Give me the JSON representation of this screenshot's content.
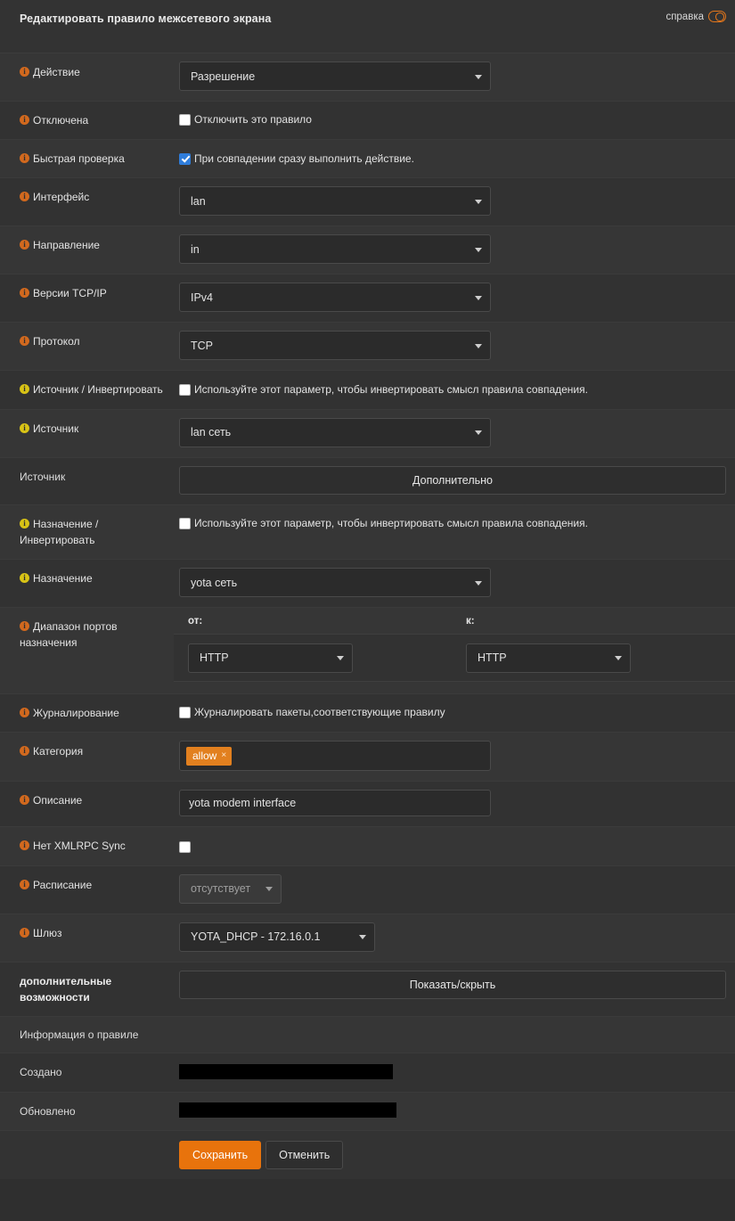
{
  "header": {
    "title": "Редактировать правило межсетевого экрана",
    "help_label": "справка",
    "help_toggle_icon": "toggle-switch-icon"
  },
  "accent": {
    "orange": "#e8730c",
    "info_orange": "#d2691e",
    "info_yellow": "#d8c316",
    "tag_orange": "#e2801f",
    "checkbox_blue": "#2f7ddb"
  },
  "fields": {
    "action": {
      "label": "Действие",
      "value": "Разрешение"
    },
    "disabled": {
      "label": "Отключена",
      "checkbox_label": "Отключить это правило",
      "checked": false
    },
    "quick": {
      "label": "Быстрая проверка",
      "checkbox_label": "При совпадении сразу выполнить действие.",
      "checked": true
    },
    "interface": {
      "label": "Интерфейс",
      "value": "lan"
    },
    "direction": {
      "label": "Направление",
      "value": "in"
    },
    "tcpip": {
      "label": "Версии TCP/IP",
      "value": "IPv4"
    },
    "protocol": {
      "label": "Протокол",
      "value": "TCP"
    },
    "source_invert": {
      "label": "Источник / Инвертировать",
      "checkbox_label": "Используйте этот параметр, чтобы инвертировать смысл правила совпадения.",
      "checked": false
    },
    "source": {
      "label": "Источник",
      "value": "lan сеть"
    },
    "source_advanced": {
      "label": "Источник",
      "button_label": "Дополнительно"
    },
    "dest_invert": {
      "label": "Назначение / Инвертировать",
      "checkbox_label": "Используйте этот параметр, чтобы инвертировать смысл правила совпадения.",
      "checked": false
    },
    "destination": {
      "label": "Назначение",
      "value": "yota сеть"
    },
    "dest_ports": {
      "label": "Диапазон портов назначения",
      "from_label": "от:",
      "to_label": "к:",
      "from_value": "HTTP",
      "to_value": "HTTP"
    },
    "logging": {
      "label": "Журналирование",
      "checkbox_label": "Журналировать пакеты,соответствующие правилу",
      "checked": false
    },
    "category": {
      "label": "Категория",
      "tag": "allow",
      "tag_remove": "×"
    },
    "description": {
      "label": "Описание",
      "value": "yota modem interface"
    },
    "no_xmlrpc": {
      "label": "Нет XMLRPC Sync",
      "checked": false
    },
    "schedule": {
      "label": "Расписание",
      "value": "отсутствует"
    },
    "gateway": {
      "label": "Шлюз",
      "value": "YOTA_DHCP - 172.16.0.1"
    },
    "advanced": {
      "label": "дополнительные возможности",
      "button_label": "Показать/скрыть"
    },
    "rule_info": {
      "label": "Информация о правиле"
    },
    "created": {
      "label": "Создано",
      "value": ""
    },
    "updated": {
      "label": "Обновлено",
      "value": ""
    }
  },
  "actions": {
    "save_label": "Сохранить",
    "cancel_label": "Отменить"
  }
}
